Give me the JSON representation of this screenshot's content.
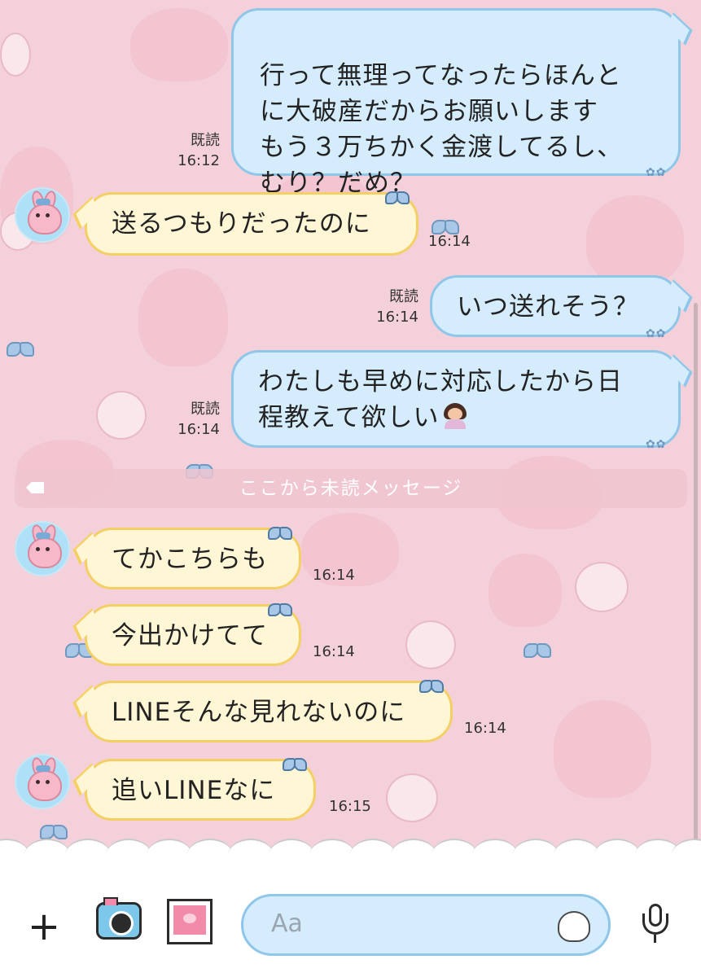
{
  "messages": [
    {
      "side": "mine",
      "text": "行って無理ってなったらほんと\nに大破産だからお願いします\nもう３万ちかく金渡してるし、\nむり？だめ？",
      "read": "既読",
      "time": "16:12"
    },
    {
      "side": "theirs",
      "text": "送るつもりだったのに",
      "time": "16:14"
    },
    {
      "side": "mine",
      "text": "いつ送れそう？",
      "read": "既読",
      "time": "16:14"
    },
    {
      "side": "mine",
      "text_line1": "わたしも早めに対応したから日",
      "text_line2": "程教えて欲しい",
      "read": "既読",
      "time": "16:14"
    },
    {
      "side": "theirs",
      "text": "てかこちらも",
      "time": "16:14"
    },
    {
      "side": "theirs",
      "text": "今出かけてて",
      "time": "16:14"
    },
    {
      "side": "theirs",
      "text": "LINEそんな見れないのに",
      "time": "16:14"
    },
    {
      "side": "theirs",
      "text": "追いLINEなに",
      "time": "16:15"
    }
  ],
  "unread_divider": "ここから未読メッセージ",
  "input": {
    "placeholder": "Aa"
  },
  "toolbar": {
    "icons": [
      "plus-icon",
      "camera-icon",
      "photo-icon",
      "sticker-icon",
      "mic-icon"
    ]
  },
  "colors": {
    "background": "#f4d1da",
    "mine_bubble": "#d4ecfb",
    "mine_border": "#8fc6e9",
    "theirs_bubble": "#fff6d6",
    "theirs_border": "#f4cf64"
  }
}
